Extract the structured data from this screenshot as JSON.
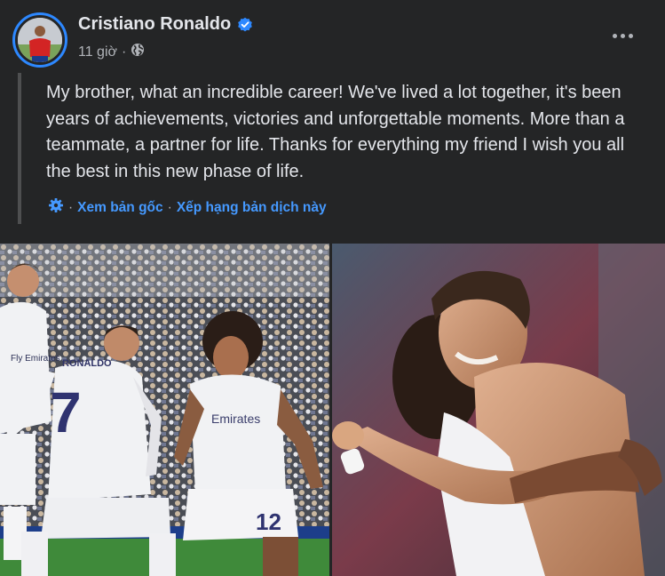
{
  "post": {
    "author": "Cristiano Ronaldo",
    "verified_icon": "verified-badge-icon",
    "time": "11 giờ",
    "separator": "·",
    "audience_icon": "globe-icon",
    "more_icon": "more-options-icon",
    "text": "My brother, what an incredible career! We've lived a lot together, it's been years of achievements, victories and unforgettable moments. More than a teammate, a partner for life. Thanks for everything my friend I wish you all the best in this new phase of life.",
    "translation": {
      "settings_icon": "gear-icon",
      "separator": "·",
      "see_original": "Xem bản gốc",
      "rate_translation": "Xếp hạng bản dịch này"
    }
  },
  "photos": {
    "left": {
      "icon": "photo-celebration-left",
      "jersey_text_back": "RONALDO",
      "jersey_number_back": "7",
      "jersey_number_front": "12",
      "sponsor": "Emirates",
      "sponsor_left": "Fly Emirates"
    },
    "right": {
      "icon": "photo-hug-right"
    }
  },
  "colors": {
    "background": "#242526",
    "primary_text": "#e4e6eb",
    "secondary_text": "#b0b3b8",
    "link": "#4599ff",
    "verified": "#2d88ff"
  }
}
